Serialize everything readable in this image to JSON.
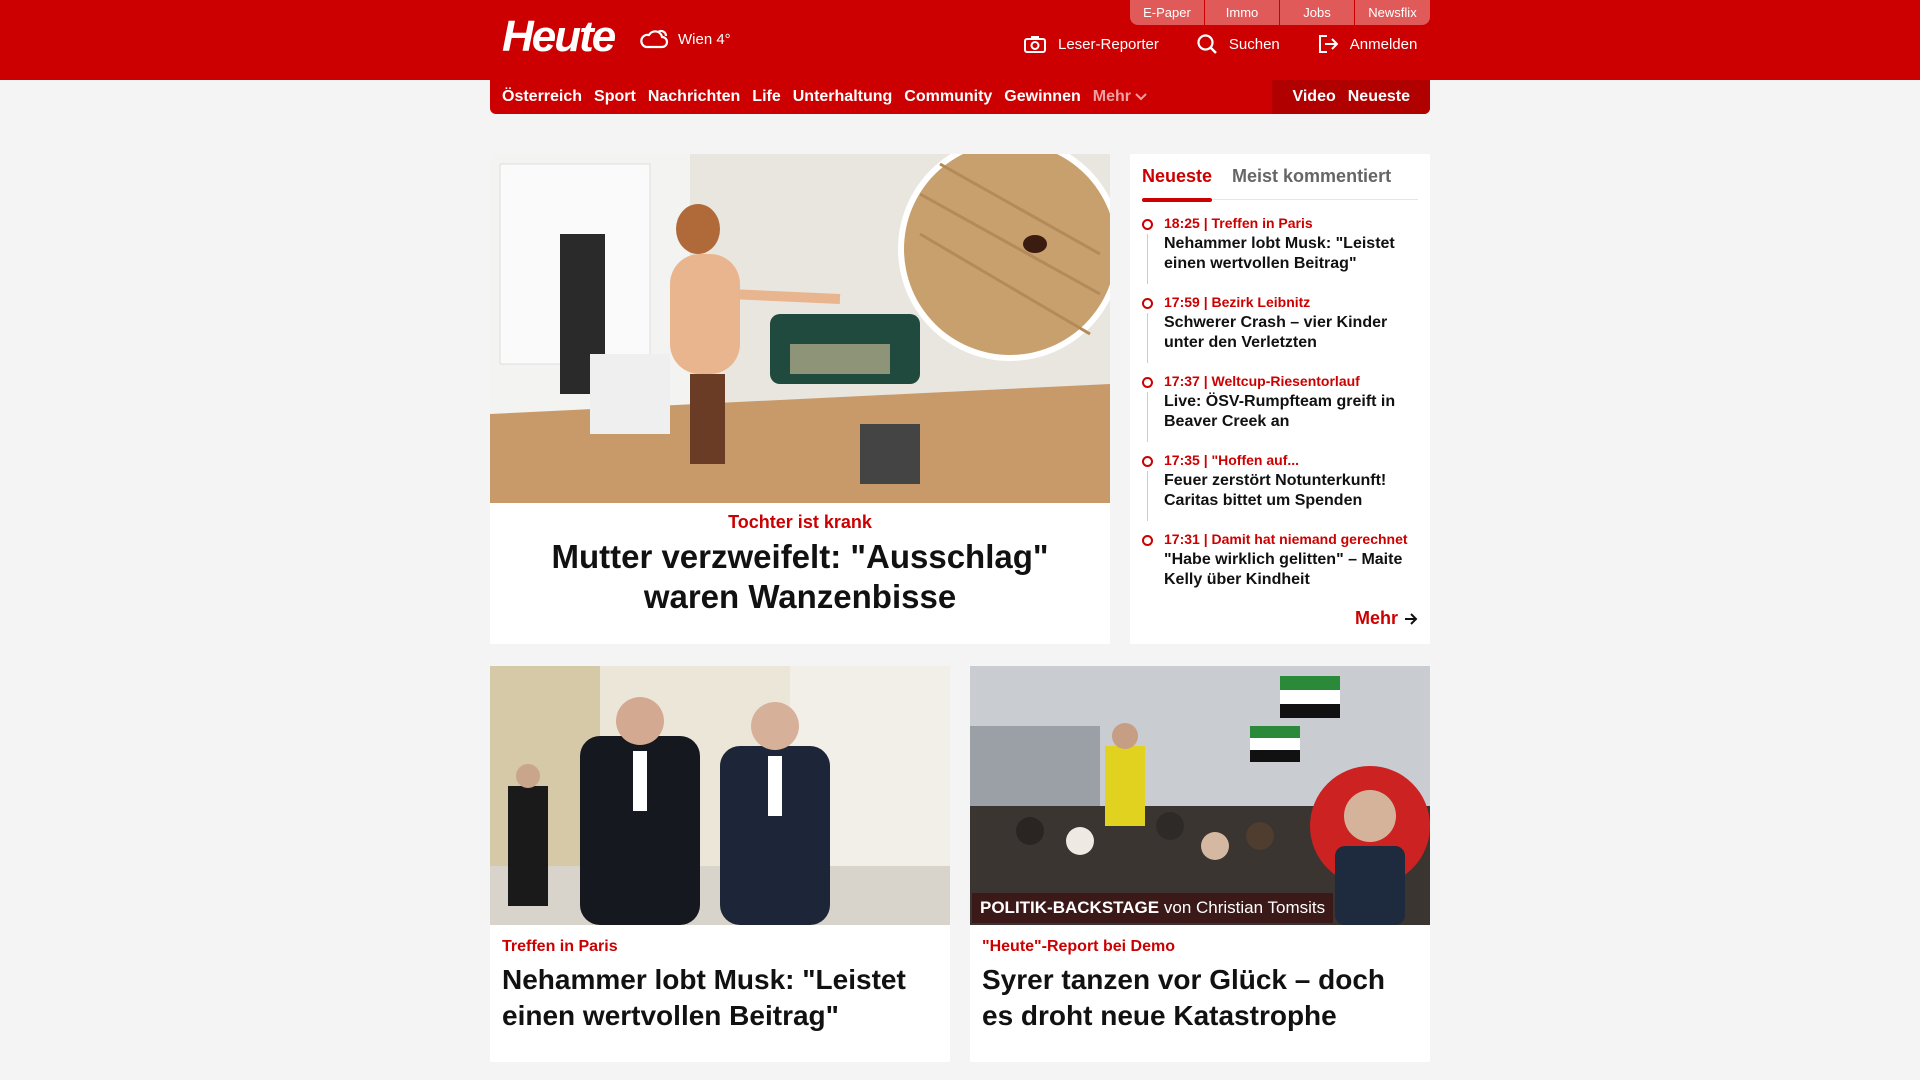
{
  "header": {
    "logo": "Heute",
    "weather": "Wien 4°",
    "top_links": [
      "E-Paper",
      "Immo",
      "Jobs",
      "Newsflix"
    ],
    "actions": {
      "reporter": "Leser-Reporter",
      "search": "Suchen",
      "login": "Anmelden"
    }
  },
  "nav": {
    "items": [
      "Österreich",
      "Sport",
      "Nachrichten",
      "Life",
      "Unterhaltung",
      "Community",
      "Gewinnen"
    ],
    "more": "Mehr",
    "right": [
      "Video",
      "Neueste"
    ]
  },
  "hero": {
    "kicker": "Tochter ist krank",
    "title": "Mutter verzweifelt: \"Ausschlag\" waren Wanzenbisse"
  },
  "sidebar": {
    "tabs": [
      "Neueste",
      "Meist kommentiert"
    ],
    "items": [
      {
        "meta": "18:25 | Treffen in Paris",
        "title": "Nehammer lobt Musk: \"Leistet einen wertvollen Beitrag\""
      },
      {
        "meta": "17:59 | Bezirk Leibnitz",
        "title": "Schwerer Crash – vier Kinder unter den Verletzten"
      },
      {
        "meta": "17:37 | Weltcup-Riesentorlauf",
        "title": "Live: ÖSV-Rumpfteam greift in Beaver Creek an"
      },
      {
        "meta": "17:35 | \"Hoffen auf...",
        "title": "Feuer zerstört Notunterkunft! Caritas bittet um Spenden"
      },
      {
        "meta": "17:31 | Damit hat niemand gerechnet",
        "title": "\"Habe wirklich gelitten\" – Maite Kelly über Kindheit"
      }
    ],
    "more": "Mehr"
  },
  "cards": [
    {
      "kicker": "Treffen in Paris",
      "title": "Nehammer lobt Musk: \"Leistet einen wertvollen Beitrag\""
    },
    {
      "kicker": "\"Heute\"-Report bei Demo",
      "title": "Syrer tanzen vor Glück – doch es droht neue Katastrophe",
      "badge_bold": "POLITIK-BACKSTAGE",
      "badge_rest": "von Christian Tomsits"
    }
  ],
  "colors": {
    "brand": "#cc0000",
    "background": "#f4f4f4"
  }
}
